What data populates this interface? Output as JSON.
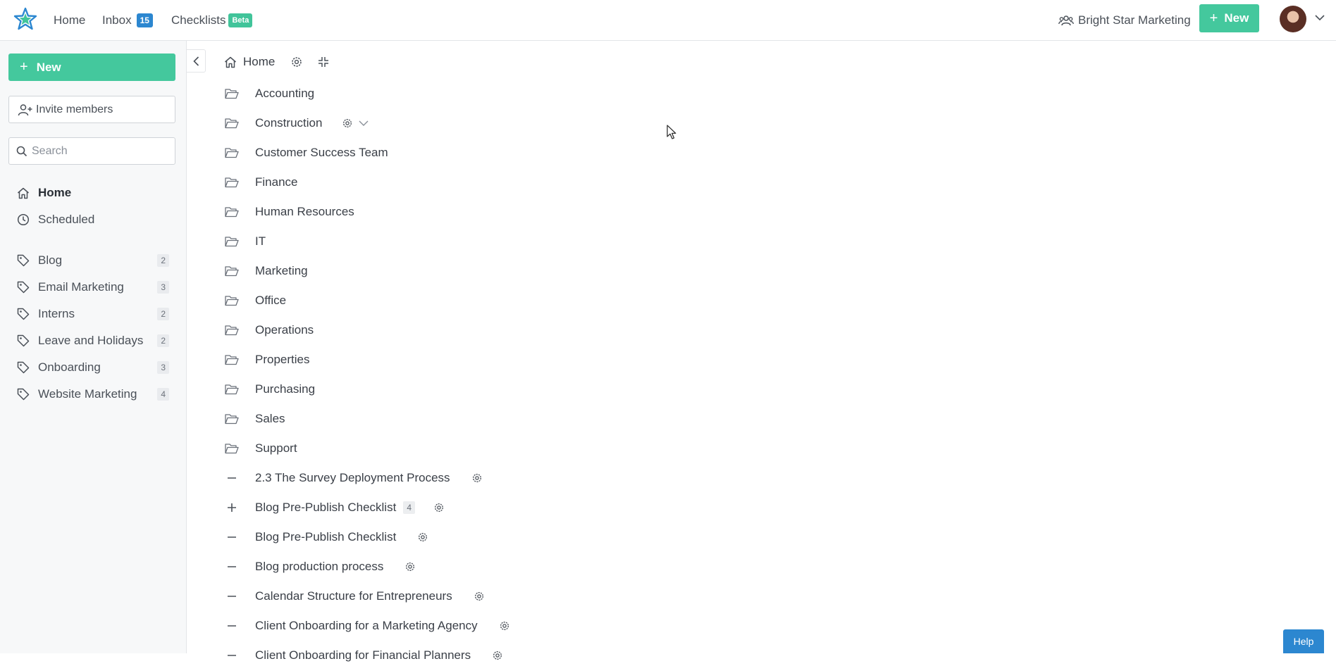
{
  "topbar": {
    "nav": [
      {
        "label": "Home"
      },
      {
        "label": "Inbox",
        "badge": "15"
      },
      {
        "label": "Checklists",
        "badge": "Beta"
      }
    ],
    "org_name": "Bright Star Marketing",
    "new_label": "New",
    "accent": "#44c89d",
    "badge_color": "#2c87d0"
  },
  "sidebar": {
    "new_label": "New",
    "invite_label": "Invite members",
    "search_placeholder": "Search",
    "nav": [
      {
        "label": "Home",
        "icon": "home-icon"
      },
      {
        "label": "Scheduled",
        "icon": "clock-icon"
      }
    ],
    "tags": [
      {
        "label": "Blog",
        "count": "2"
      },
      {
        "label": "Email Marketing",
        "count": "3"
      },
      {
        "label": "Interns",
        "count": "2"
      },
      {
        "label": "Leave and Holidays",
        "count": "2"
      },
      {
        "label": "Onboarding",
        "count": "3"
      },
      {
        "label": "Website Marketing",
        "count": "4"
      }
    ]
  },
  "main": {
    "breadcrumb": "Home",
    "folders": [
      {
        "label": "Accounting"
      },
      {
        "label": "Construction",
        "hovered": true
      },
      {
        "label": "Customer Success Team"
      },
      {
        "label": "Finance"
      },
      {
        "label": "Human Resources"
      },
      {
        "label": "IT"
      },
      {
        "label": "Marketing"
      },
      {
        "label": "Office"
      },
      {
        "label": "Operations"
      },
      {
        "label": "Properties"
      },
      {
        "label": "Purchasing"
      },
      {
        "label": "Sales"
      },
      {
        "label": "Support"
      }
    ],
    "templates": [
      {
        "label": "2.3 The Survey Deployment Process",
        "icon": "minus-icon"
      },
      {
        "label": "Blog Pre-Publish Checklist",
        "icon": "plus-icon",
        "count": "4"
      },
      {
        "label": "Blog Pre-Publish Checklist",
        "icon": "minus-icon"
      },
      {
        "label": "Blog production process",
        "icon": "minus-icon"
      },
      {
        "label": "Calendar Structure for Entrepreneurs",
        "icon": "minus-icon"
      },
      {
        "label": "Client Onboarding for a Marketing Agency",
        "icon": "minus-icon"
      },
      {
        "label": "Client Onboarding for Financial Planners",
        "icon": "minus-icon"
      }
    ]
  },
  "help_label": "Help"
}
